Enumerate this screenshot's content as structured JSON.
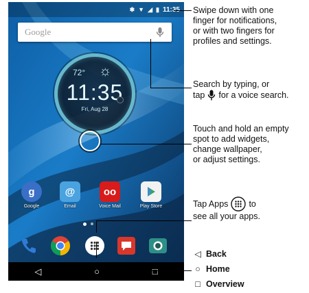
{
  "status_bar": {
    "time": "11:35"
  },
  "search": {
    "placeholder": "Google"
  },
  "clock_widget": {
    "temperature": "72°",
    "time": "11:35",
    "date": "Fri, Aug 28"
  },
  "apps": [
    {
      "label": "Google",
      "icon": "google-search-icon",
      "color": "#3a6fc7"
    },
    {
      "label": "Email",
      "icon": "email-icon",
      "color": "#4aa3df"
    },
    {
      "label": "Voice Mail",
      "icon": "voicemail-icon",
      "color": "#d81b1b"
    },
    {
      "label": "Play Store",
      "icon": "play-store-icon",
      "color": "#f2f2f2"
    }
  ],
  "dock": [
    {
      "name": "phone",
      "icon": "phone-icon",
      "color": "#2f7bd6"
    },
    {
      "name": "chrome",
      "icon": "chrome-icon"
    },
    {
      "name": "apps",
      "icon": "apps-launcher-icon"
    },
    {
      "name": "messaging",
      "icon": "messaging-icon",
      "color": "#d9372b"
    },
    {
      "name": "camera",
      "icon": "camera-icon",
      "color": "#2e8f86"
    }
  ],
  "callouts": {
    "notifications": [
      "Swipe down with one",
      "finger for notifications,",
      "or with two fingers for",
      "profiles and settings."
    ],
    "search_a": "Search by typing, or",
    "search_b_pre": "tap",
    "search_b_post": "for a voice search.",
    "widgets": [
      "Touch and hold an empty",
      "spot to add widgets,",
      "change wallpaper,",
      "or adjust settings."
    ],
    "apps_a_pre": "Tap Apps",
    "apps_a_post": "to",
    "apps_b": "see all your apps."
  },
  "legend": {
    "back": "Back",
    "home": "Home",
    "overview": "Overview"
  }
}
